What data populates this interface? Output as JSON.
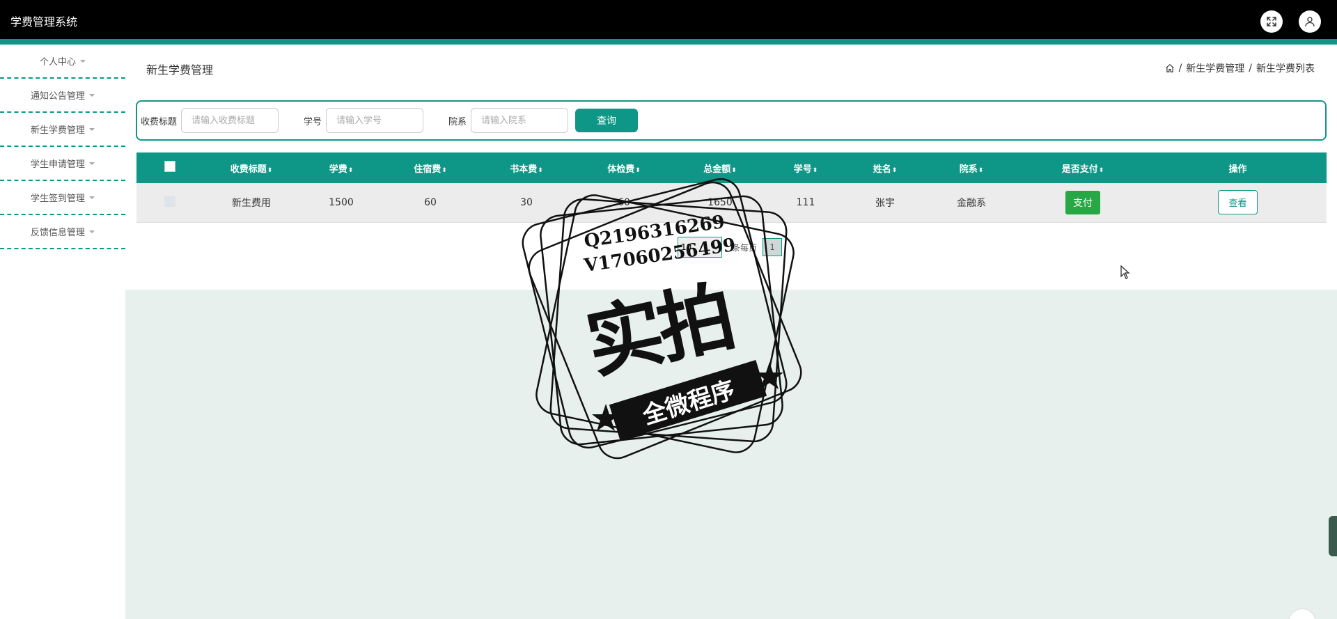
{
  "app": {
    "title": "学费管理系统"
  },
  "sidebar": {
    "items": [
      {
        "label": "个人中心"
      },
      {
        "label": "通知公告管理"
      },
      {
        "label": "新生学费管理"
      },
      {
        "label": "学生申请管理"
      },
      {
        "label": "学生签到管理"
      },
      {
        "label": "反馈信息管理"
      }
    ]
  },
  "page": {
    "title": "新生学费管理",
    "breadcrumb": [
      "新生学费管理",
      "新生学费列表"
    ]
  },
  "search": {
    "fee_title_label": "收费标题",
    "fee_title_placeholder": "请输入收费标题",
    "student_no_label": "学号",
    "student_no_placeholder": "请输入学号",
    "department_label": "院系",
    "department_placeholder": "请输入院系",
    "query_button": "查询"
  },
  "table": {
    "headers": [
      "收费标题",
      "学费",
      "住宿费",
      "书本费",
      "体检费",
      "总金额",
      "学号",
      "姓名",
      "院系",
      "是否支付",
      "操作"
    ],
    "rows": [
      {
        "title": "新生费用",
        "tuition": "1500",
        "dorm": "60",
        "books": "30",
        "exam": "60",
        "total": "1650",
        "student_no": "111",
        "name": "张宇",
        "department": "金融系",
        "pay_label": "支付",
        "view_label": "查看"
      }
    ]
  },
  "pagination": {
    "page_size": "10",
    "per_page_label": "条每页",
    "current_page": "1"
  },
  "watermark": {
    "line1": "Q2196316269",
    "line2": "V17060256499",
    "big": "实拍",
    "ribbon": "全微程序"
  }
}
